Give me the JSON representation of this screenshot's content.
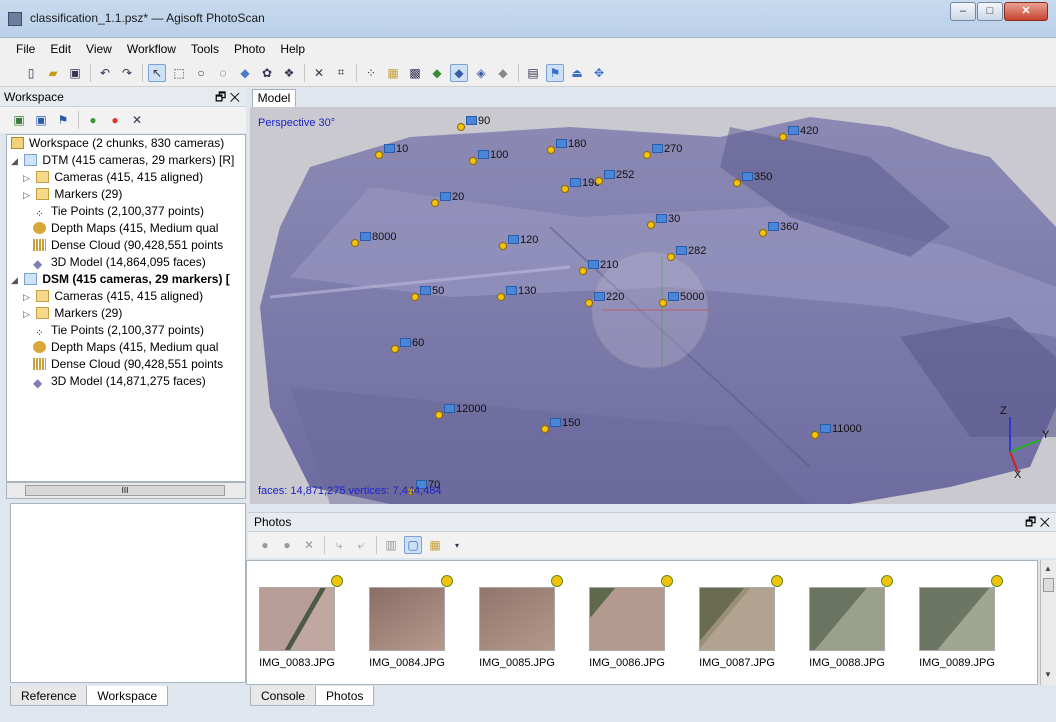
{
  "window": {
    "title": "classification_1.1.psz* — Agisoft PhotoScan",
    "minimize": "–",
    "maximize": "□",
    "close": "✕"
  },
  "menu": [
    "File",
    "Edit",
    "View",
    "Workflow",
    "Tools",
    "Photo",
    "Help"
  ],
  "toolbar_icons": [
    "new-icon",
    "open-icon",
    "save-icon",
    "sep",
    "undo-icon",
    "redo-icon",
    "sep",
    "select-pointer-icon",
    "rect-select-icon",
    "circle-select-icon",
    "free-select-icon",
    "sep",
    "show-cameras-icon",
    "show-points-icon",
    "show-dense-icon",
    "sep",
    "delete-icon",
    "crop-icon",
    "sep",
    "tie-points-icon",
    "dense-cloud-icon",
    "shaded-icon",
    "solid-icon",
    "textured-icon",
    "wireframe-icon",
    "dem-icon",
    "sep",
    "show-images-icon",
    "show-markers-icon",
    "show-shapes-icon",
    "navigation-icon"
  ],
  "workspace": {
    "title": "Workspace",
    "header_buttons": "🗗 ✕",
    "root": "Workspace (2 chunks, 830 cameras)",
    "chunks": [
      {
        "label": "DTM (415 cameras, 29 markers) [R]",
        "items": [
          "Cameras (415, 415 aligned)",
          "Markers (29)",
          "Tie Points (2,100,377 points)",
          "Depth Maps (415, Medium qual",
          "Dense Cloud (90,428,551 points",
          "3D Model (14,864,095 faces)"
        ]
      },
      {
        "label": "DSM (415 cameras, 29 markers) [",
        "items": [
          "Cameras (415, 415 aligned)",
          "Markers (29)",
          "Tie Points (2,100,377 points)",
          "Depth Maps (415, Medium qual",
          "Dense Cloud (90,428,551 points",
          "3D Model (14,871,275 faces)"
        ]
      }
    ],
    "scroll_thumb": "III",
    "tabs": [
      "Reference",
      "Workspace"
    ]
  },
  "model": {
    "tab": "Model",
    "perspective": "Perspective 30°",
    "stats": "faces: 14,871,275 vertices: 7,444,484",
    "axis_labels": {
      "z": "Z",
      "y": "Y",
      "x": "X"
    },
    "markers": [
      "90",
      "10",
      "100",
      "180",
      "270",
      "420",
      "190",
      "252",
      "350",
      "20",
      "30",
      "360",
      "8000",
      "120",
      "282",
      "210",
      "50",
      "130",
      "220",
      "5000",
      "60",
      "12000",
      "150",
      "11000",
      "70"
    ]
  },
  "photos": {
    "title": "Photos",
    "header_buttons": "🗗 ✕",
    "items": [
      "IMG_0083.JPG",
      "IMG_0084.JPG",
      "IMG_0085.JPG",
      "IMG_0086.JPG",
      "IMG_0087.JPG",
      "IMG_0088.JPG",
      "IMG_0089.JPG"
    ],
    "thumb_colors": [
      "#9a8a86",
      "#a38a80",
      "#a58a7e",
      "#a68e82",
      "#8f8a78",
      "#7f8571",
      "#7f8771"
    ],
    "tabs": [
      "Console",
      "Photos"
    ]
  },
  "colors": {
    "mesh": "#7c7aa8",
    "label_blue": "#1a22c8"
  }
}
